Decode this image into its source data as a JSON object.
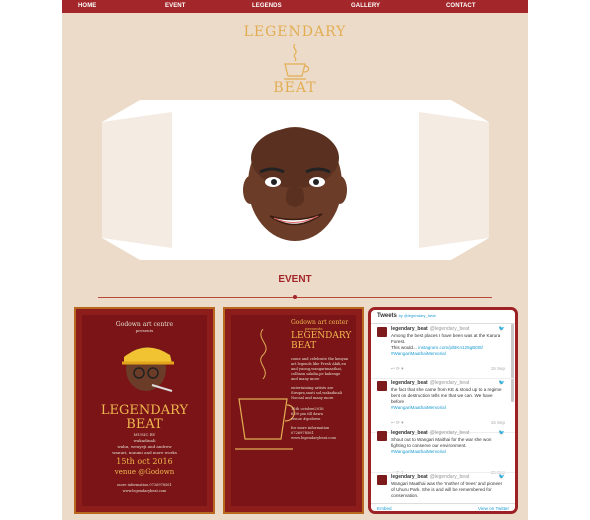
{
  "nav": {
    "items": [
      "HOME",
      "EVENT",
      "LEGENDS",
      "GALLERY",
      "CONTACT"
    ]
  },
  "logo": {
    "line1": "LEGENDARY",
    "line2": "BEAT"
  },
  "section": {
    "title": "EVENT"
  },
  "poster1": {
    "venue_top": "Godown art centre",
    "presents": "presents",
    "title1": "LEGENDARY",
    "title2": "BEAT",
    "subtitle": "MUSIC BY",
    "line_a": "wakadinali",
    "line_b": "wahu, wenyeji and andrew",
    "line_c": "wanuri, muumi and more works",
    "date": "15th oct 2016",
    "venue": "venue @Godown",
    "info1": "more information 0726978561",
    "info2": "www.legendarybeat.com"
  },
  "poster2": {
    "venue_top": "Godown art center",
    "presents": "presents",
    "title1": "LEGENDARY",
    "title2": "BEAT",
    "body1": "come and celebrate the kenyan",
    "body2": "art legends like Fresh Akili,en",
    "body3": "and yuong,wangarimaathai,",
    "body4": "collinsn sakdia,pe kahenge",
    "body5": "and many more",
    "body6": "entertaining artists are",
    "body7": "Sirupra,sauti sol,wakadinali",
    "body8": "Nocnal and many more",
    "date1": "15th octobre2016",
    "date2": "6:00 pm till dawn",
    "date3": "venue #godown",
    "info1": "for more information",
    "info2": "0726978561",
    "info3": "www.legendarybeat.com"
  },
  "tweets": {
    "header": "Tweets",
    "via": "by @legendary_beat",
    "items": [
      {
        "name": "legendary_beat",
        "handle": "@legendary_beat",
        "text1": "Among the best places I have been was at the Karura Forest.",
        "text2": "This would...",
        "link": "instagram.com/p/BKn125gB00t/",
        "tag": "#WangariMaathaiMemorial",
        "time": "15 Sep"
      },
      {
        "name": "legendary_beat",
        "handle": "@legendary_beat",
        "text1": "the fact that she came from KE & stood up to a regime bent on destruction tells me that we can. We have before",
        "text2": "",
        "link": "",
        "tag": "#WangariMaathaiMemorial",
        "time": "15 Sep"
      },
      {
        "name": "legendary_beat",
        "handle": "@legendary_beat",
        "text1": "Shout out to Wangari Maithai for the war she won fighting to conserve our environment.",
        "text2": "",
        "link": "",
        "tag": "#WangariMaathaiMemorial",
        "time": "15 Sep"
      },
      {
        "name": "legendary_beat",
        "handle": "@legendary_beat",
        "text1": "Wangari Maathai was the 'mother of trees' and pioneer of Uhuru Park. She is and will be remembered for conservation.",
        "text2": "",
        "link": "",
        "tag": "",
        "time": "15 Sep"
      }
    ],
    "embed": "Embed",
    "view": "View on Twitter"
  },
  "colors": {
    "nav": "#a3262a",
    "page_bg": "#ecdbc8",
    "logo": "#e2ae54",
    "poster_bg": "#8c1d1a",
    "accent": "#a3262a"
  }
}
